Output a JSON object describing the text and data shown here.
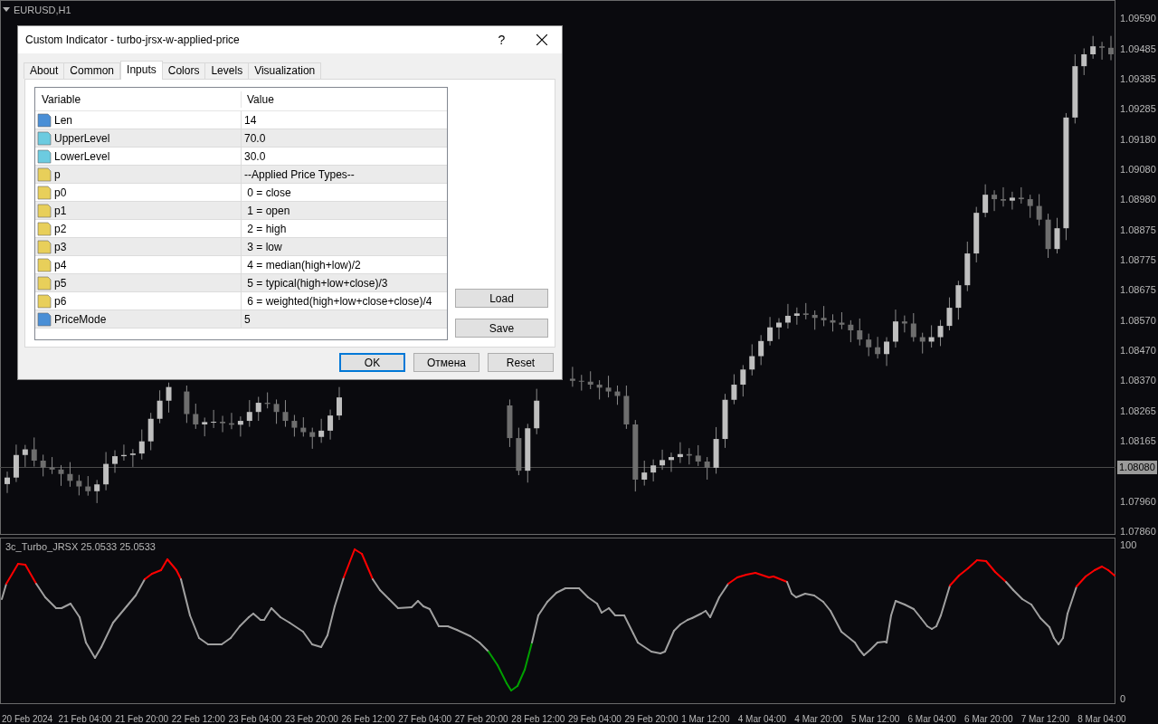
{
  "chart": {
    "symbol": "EURUSD,H1",
    "current_price": "1.08080",
    "chart_data": {
      "type": "candlestick",
      "ylim": [
        1.07852,
        1.09651
      ],
      "yticks": [
        {
          "value": 1.0959,
          "label": "1.09590"
        },
        {
          "value": 1.09485,
          "label": "1.09485"
        },
        {
          "value": 1.09385,
          "label": "1.09385"
        },
        {
          "value": 1.09285,
          "label": "1.09285"
        },
        {
          "value": 1.0918,
          "label": "1.09180"
        },
        {
          "value": 1.0908,
          "label": "1.09080"
        },
        {
          "value": 1.0898,
          "label": "1.08980"
        },
        {
          "value": 1.08875,
          "label": "1.08875"
        },
        {
          "value": 1.08775,
          "label": "1.08775"
        },
        {
          "value": 1.08675,
          "label": "1.08675"
        },
        {
          "value": 1.0857,
          "label": "1.08570"
        },
        {
          "value": 1.0847,
          "label": "1.08470"
        },
        {
          "value": 1.0837,
          "label": "1.08370"
        },
        {
          "value": 1.08265,
          "label": "1.08265"
        },
        {
          "value": 1.08165,
          "label": "1.08165"
        },
        {
          "value": 1.0796,
          "label": "1.07960"
        },
        {
          "value": 1.0786,
          "label": "1.07860"
        }
      ],
      "categories": [
        null,
        null,
        null,
        null,
        null,
        null,
        null,
        null,
        null,
        null,
        null,
        null,
        null,
        null,
        null,
        null,
        null,
        null,
        null,
        null,
        null,
        null,
        null,
        null,
        null,
        null,
        null,
        null,
        null,
        null,
        null,
        null,
        null,
        null,
        null,
        null,
        null,
        null,
        null,
        null,
        null,
        null,
        null,
        null,
        null,
        null,
        null,
        null,
        null,
        null,
        null,
        null,
        null,
        null,
        null,
        null,
        null,
        null,
        null,
        null,
        null,
        null,
        null,
        null,
        null,
        null,
        null,
        null,
        null,
        null,
        null,
        null,
        null,
        null,
        null,
        null,
        null,
        null,
        null,
        null,
        null,
        null,
        null,
        null,
        null,
        null,
        null,
        null,
        null,
        null,
        null,
        null,
        null,
        null,
        null,
        null,
        null,
        null,
        null,
        null,
        null,
        null,
        null,
        null,
        null,
        null,
        null,
        null,
        null,
        null,
        null,
        null,
        null,
        null,
        null,
        null,
        null,
        null,
        null,
        null,
        null,
        null,
        null,
        null
      ],
      "ohlc": [
        [
          1.0802,
          1.08062,
          1.0799,
          1.08042
        ],
        [
          1.08042,
          1.08153,
          1.08027,
          1.08118
        ],
        [
          1.08118,
          1.08152,
          1.08078,
          1.08137
        ],
        [
          1.08137,
          1.08177,
          1.08079,
          1.08099
        ],
        [
          1.08099,
          1.08119,
          1.08046,
          1.08076
        ],
        [
          1.08076,
          1.08111,
          1.08054,
          1.08069
        ],
        [
          1.08069,
          1.08084,
          1.08014,
          1.08054
        ],
        [
          1.08054,
          1.08094,
          1.08011,
          1.08031
        ],
        [
          1.08031,
          1.08051,
          1.07982,
          1.08012
        ],
        [
          1.08012,
          1.08047,
          1.07981,
          1.07996
        ],
        [
          1.07996,
          1.08034,
          1.07956,
          1.08019
        ],
        [
          1.08019,
          1.08128,
          1.07999,
          1.08088
        ],
        [
          1.08088,
          1.08134,
          1.08058,
          1.08114
        ],
        [
          1.08114,
          1.08153,
          1.08099,
          1.08118
        ],
        [
          1.08118,
          1.08138,
          1.08078,
          1.08123
        ],
        [
          1.08123,
          1.08204,
          1.08103,
          1.08164
        ],
        [
          1.08164,
          1.0826,
          1.08134,
          1.0824
        ],
        [
          1.0824,
          1.08336,
          1.08225,
          1.08301
        ],
        [
          1.08301,
          1.08362,
          1.08261,
          1.08347
        ],
        null,
        [
          1.08332,
          1.08352,
          1.08226,
          1.08256
        ],
        [
          1.08256,
          1.08291,
          1.08206,
          1.08221
        ],
        [
          1.08221,
          1.08244,
          1.08181,
          1.08229
        ],
        [
          1.08229,
          1.0827,
          1.08209,
          1.0823
        ],
        [
          1.0823,
          1.0825,
          1.08195,
          1.08225
        ],
        [
          1.08225,
          1.0826,
          1.08205,
          1.0822
        ],
        [
          1.0822,
          1.08248,
          1.0818,
          1.08233
        ],
        [
          1.08233,
          1.08303,
          1.08213,
          1.08263
        ],
        [
          1.08263,
          1.08314,
          1.08233,
          1.08294
        ],
        [
          1.08294,
          1.08329,
          1.08275,
          1.0829
        ],
        [
          1.0829,
          1.08305,
          1.08223,
          1.08263
        ],
        [
          1.08263,
          1.08303,
          1.08213,
          1.08233
        ],
        [
          1.08233,
          1.08253,
          1.0818,
          1.0821
        ],
        [
          1.0821,
          1.08245,
          1.0818,
          1.08195
        ],
        [
          1.08195,
          1.0821,
          1.08139,
          1.08179
        ],
        [
          1.08179,
          1.0824,
          1.08159,
          1.082
        ],
        [
          1.082,
          1.08271,
          1.0817,
          1.08251
        ],
        [
          1.08251,
          1.08347,
          1.08236,
          1.08312
        ],
        null,
        null,
        null,
        null,
        null,
        null,
        null,
        null,
        null,
        null,
        null,
        null,
        null,
        null,
        null,
        null,
        null,
        null,
        [
          1.08285,
          1.08305,
          1.08145,
          1.08175
        ],
        [
          1.08175,
          1.0821,
          1.0805,
          1.08065
        ],
        [
          1.08065,
          1.08223,
          1.08025,
          1.08208
        ],
        [
          1.08208,
          1.08341,
          1.08188,
          1.08301
        ],
        null,
        null,
        null,
        [
          1.08375,
          1.08415,
          1.08348,
          1.08368
        ],
        [
          1.08368,
          1.08388,
          1.08335,
          1.08365
        ],
        [
          1.08365,
          1.084,
          1.0834,
          1.08355
        ],
        [
          1.08355,
          1.0837,
          1.08305,
          1.08345
        ],
        [
          1.08345,
          1.08385,
          1.08312,
          1.08332
        ],
        [
          1.08332,
          1.08352,
          1.08287,
          1.08317
        ],
        [
          1.08317,
          1.08352,
          1.08206,
          1.08221
        ],
        [
          1.08221,
          1.08236,
          1.07995,
          1.08035
        ],
        [
          1.08035,
          1.08099,
          1.08015,
          1.08059
        ],
        [
          1.08059,
          1.08103,
          1.08029,
          1.08083
        ],
        [
          1.08083,
          1.08136,
          1.08068,
          1.08101
        ],
        [
          1.08101,
          1.08126,
          1.08061,
          1.08111
        ],
        [
          1.08111,
          1.08161,
          1.08091,
          1.08121
        ],
        [
          1.08121,
          1.08141,
          1.08086,
          1.08116
        ],
        [
          1.08116,
          1.08151,
          1.08081,
          1.08096
        ],
        [
          1.08096,
          1.08111,
          1.08035,
          1.08075
        ],
        [
          1.08075,
          1.08212,
          1.08055,
          1.08172
        ],
        [
          1.08172,
          1.08324,
          1.08142,
          1.08304
        ],
        [
          1.08304,
          1.0839,
          1.08289,
          1.08355
        ],
        [
          1.08355,
          1.08421,
          1.08315,
          1.08406
        ],
        [
          1.08406,
          1.08491,
          1.08386,
          1.08451
        ],
        [
          1.08451,
          1.08522,
          1.08421,
          1.08502
        ],
        [
          1.08502,
          1.08583,
          1.08487,
          1.08548
        ],
        [
          1.08548,
          1.08579,
          1.08508,
          1.08564
        ],
        [
          1.08564,
          1.08627,
          1.08544,
          1.08587
        ],
        [
          1.08587,
          1.08615,
          1.08557,
          1.08595
        ],
        [
          1.08595,
          1.0863,
          1.08575,
          1.0859
        ],
        [
          1.0859,
          1.08605,
          1.0854,
          1.0858
        ],
        [
          1.0858,
          1.0862,
          1.08552,
          1.08572
        ],
        [
          1.08572,
          1.08592,
          1.08534,
          1.08564
        ],
        [
          1.08564,
          1.08599,
          1.08542,
          1.08557
        ],
        [
          1.08557,
          1.08572,
          1.08498,
          1.08538
        ],
        [
          1.08538,
          1.08578,
          1.08487,
          1.08507
        ],
        [
          1.08507,
          1.08527,
          1.08451,
          1.08481
        ],
        [
          1.08481,
          1.08516,
          1.08443,
          1.08458
        ],
        [
          1.08458,
          1.08515,
          1.08418,
          1.085
        ],
        [
          1.085,
          1.08608,
          1.0848,
          1.08568
        ],
        [
          1.08568,
          1.08588,
          1.08531,
          1.08561
        ],
        [
          1.08561,
          1.08596,
          1.085,
          1.08515
        ],
        [
          1.08515,
          1.0853,
          1.0846,
          1.085
        ],
        [
          1.085,
          1.08555,
          1.0848,
          1.08515
        ],
        [
          1.08515,
          1.08573,
          1.08485,
          1.08553
        ],
        [
          1.08553,
          1.08649,
          1.08538,
          1.08614
        ],
        [
          1.08614,
          1.08705,
          1.08574,
          1.0869
        ],
        [
          1.0869,
          1.08837,
          1.0867,
          1.08797
        ],
        [
          1.08797,
          1.08954,
          1.08767,
          1.08934
        ],
        [
          1.08934,
          1.0903,
          1.08919,
          1.08995
        ],
        [
          1.08995,
          1.0901,
          1.0894,
          1.0898
        ],
        [
          1.0898,
          1.0902,
          1.08955,
          1.08975
        ],
        [
          1.08975,
          1.09005,
          1.08945,
          1.08985
        ],
        [
          1.08985,
          1.0902,
          1.08965,
          1.0898
        ],
        [
          1.0898,
          1.08995,
          1.08917,
          1.08957
        ],
        [
          1.08957,
          1.08997,
          1.08891,
          1.08911
        ],
        [
          1.08911,
          1.08931,
          1.08782,
          1.08812
        ],
        [
          1.08812,
          1.08917,
          1.08797,
          1.08882
        ],
        [
          1.08882,
          1.0927,
          1.08842,
          1.09255
        ],
        [
          1.09255,
          1.09468,
          1.09235,
          1.09428
        ],
        [
          1.09428,
          1.09488,
          1.09398,
          1.09468
        ],
        [
          1.09468,
          1.0953,
          1.09453,
          1.09495
        ],
        [
          1.09495,
          1.0951,
          1.0945,
          1.0949
        ],
        [
          1.0949,
          1.0953,
          1.09448,
          1.09468
        ]
      ]
    },
    "indicator": {
      "label": "3c_Turbo_JRSX 25.0533 25.0533",
      "axis": [
        "100",
        "0"
      ]
    },
    "time_axis": [
      "20 Feb 2024",
      "21 Feb 04:00",
      "21 Feb 20:00",
      "22 Feb 12:00",
      "23 Feb 04:00",
      "23 Feb 20:00",
      "26 Feb 12:00",
      "27 Feb 04:00",
      "27 Feb 20:00",
      "28 Feb 12:00",
      "29 Feb 04:00",
      "29 Feb 20:00",
      "1 Mar 12:00",
      "4 Mar 04:00",
      "4 Mar 20:00",
      "5 Mar 12:00",
      "6 Mar 04:00",
      "6 Mar 20:00",
      "7 Mar 12:00",
      "8 Mar 04:00"
    ]
  },
  "dialog": {
    "title": "Custom Indicator - turbo-jrsx-w-applied-price",
    "help": "?",
    "tabs": [
      {
        "label": "About",
        "selected": false
      },
      {
        "label": "Common",
        "selected": false
      },
      {
        "label": "Inputs",
        "selected": true
      },
      {
        "label": "Colors",
        "selected": false
      },
      {
        "label": "Levels",
        "selected": false
      },
      {
        "label": "Visualization",
        "selected": false
      }
    ],
    "table": {
      "columns": [
        "Variable",
        "Value"
      ],
      "rows": [
        {
          "kind": "int",
          "variable": "Len",
          "value": "14"
        },
        {
          "kind": "double",
          "variable": "UpperLevel",
          "value": "70.0"
        },
        {
          "kind": "double",
          "variable": "LowerLevel",
          "value": "30.0"
        },
        {
          "kind": "string",
          "variable": "p",
          "value": "--Applied Price Types--"
        },
        {
          "kind": "string",
          "variable": "p0",
          "value": " 0 = close"
        },
        {
          "kind": "string",
          "variable": "p1",
          "value": " 1 = open"
        },
        {
          "kind": "string",
          "variable": "p2",
          "value": " 2 = high"
        },
        {
          "kind": "string",
          "variable": "p3",
          "value": " 3 = low"
        },
        {
          "kind": "string",
          "variable": "p4",
          "value": " 4 = median(high+low)/2"
        },
        {
          "kind": "string",
          "variable": "p5",
          "value": " 5 = typical(high+low+close)/3"
        },
        {
          "kind": "string",
          "variable": "p6",
          "value": " 6 = weighted(high+low+close+close)/4"
        },
        {
          "kind": "int",
          "variable": "PriceMode",
          "value": "5"
        }
      ]
    },
    "side_buttons": [
      "Load",
      "Save"
    ],
    "buttons": [
      {
        "label": "OK",
        "default": true
      },
      {
        "label": "Отмена",
        "default": false
      },
      {
        "label": "Reset",
        "default": false
      }
    ]
  }
}
